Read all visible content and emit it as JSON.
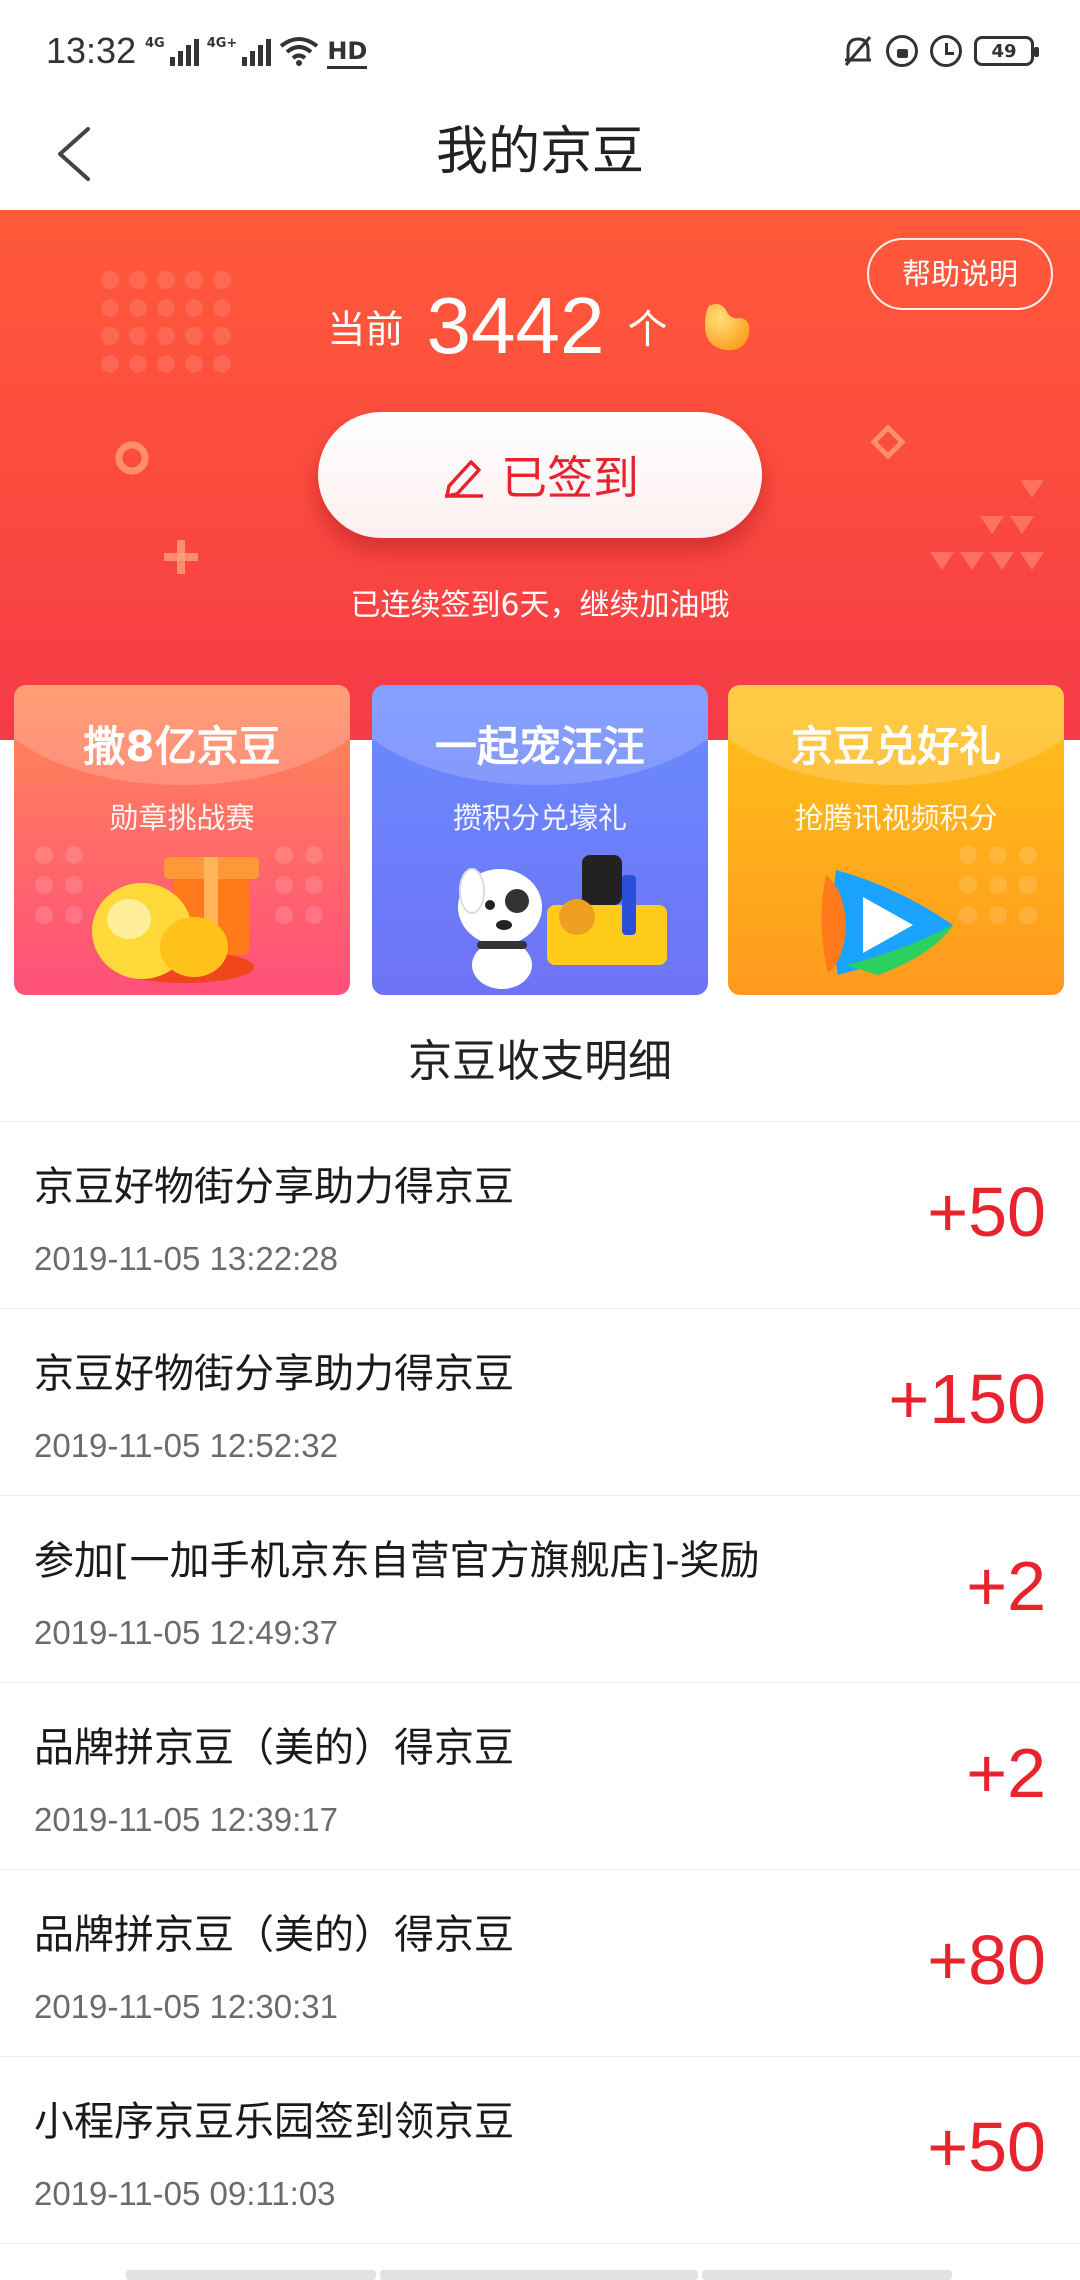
{
  "status_bar": {
    "time": "13:32",
    "network_1": "4G",
    "network_2": "4G+",
    "hd_label": "HD",
    "battery": "49"
  },
  "nav": {
    "title": "我的京豆",
    "back_icon": "chevron-left-icon"
  },
  "hero": {
    "help_label": "帮助说明",
    "balance_label": "当前",
    "balance_value": "3442",
    "balance_unit": "个",
    "sign_label": "已签到",
    "sign_note": "已连续签到6天，继续加油哦",
    "colors": {
      "gradient_top": "#ff5a3a",
      "gradient_bottom": "#f53a48",
      "sign_text": "#e8232e"
    }
  },
  "cards": [
    {
      "title": "撒8亿京豆",
      "subtitle": "勋章挑战赛",
      "color": "#ff6a68"
    },
    {
      "title": "一起宠汪汪",
      "subtitle": "攒积分兑壕礼",
      "color": "#6a80fa"
    },
    {
      "title": "京豆兑好礼",
      "subtitle": "抢腾讯视频积分",
      "color": "#ffae1e"
    }
  ],
  "section_title": "京豆收支明细",
  "transactions": [
    {
      "title": "京豆好物街分享助力得京豆",
      "date": "2019-11-05 13:22:28",
      "amount": "+50"
    },
    {
      "title": "京豆好物街分享助力得京豆",
      "date": "2019-11-05 12:52:32",
      "amount": "+150"
    },
    {
      "title": "参加[一加手机京东自营官方旗舰店]-奖励",
      "date": "2019-11-05 12:49:37",
      "amount": "+2"
    },
    {
      "title": "品牌拼京豆（美的）得京豆",
      "date": "2019-11-05 12:39:17",
      "amount": "+2"
    },
    {
      "title": "品牌拼京豆（美的）得京豆",
      "date": "2019-11-05 12:30:31",
      "amount": "+80"
    },
    {
      "title": "小程序京豆乐园签到领京豆",
      "date": "2019-11-05 09:11:03",
      "amount": "+50"
    }
  ]
}
